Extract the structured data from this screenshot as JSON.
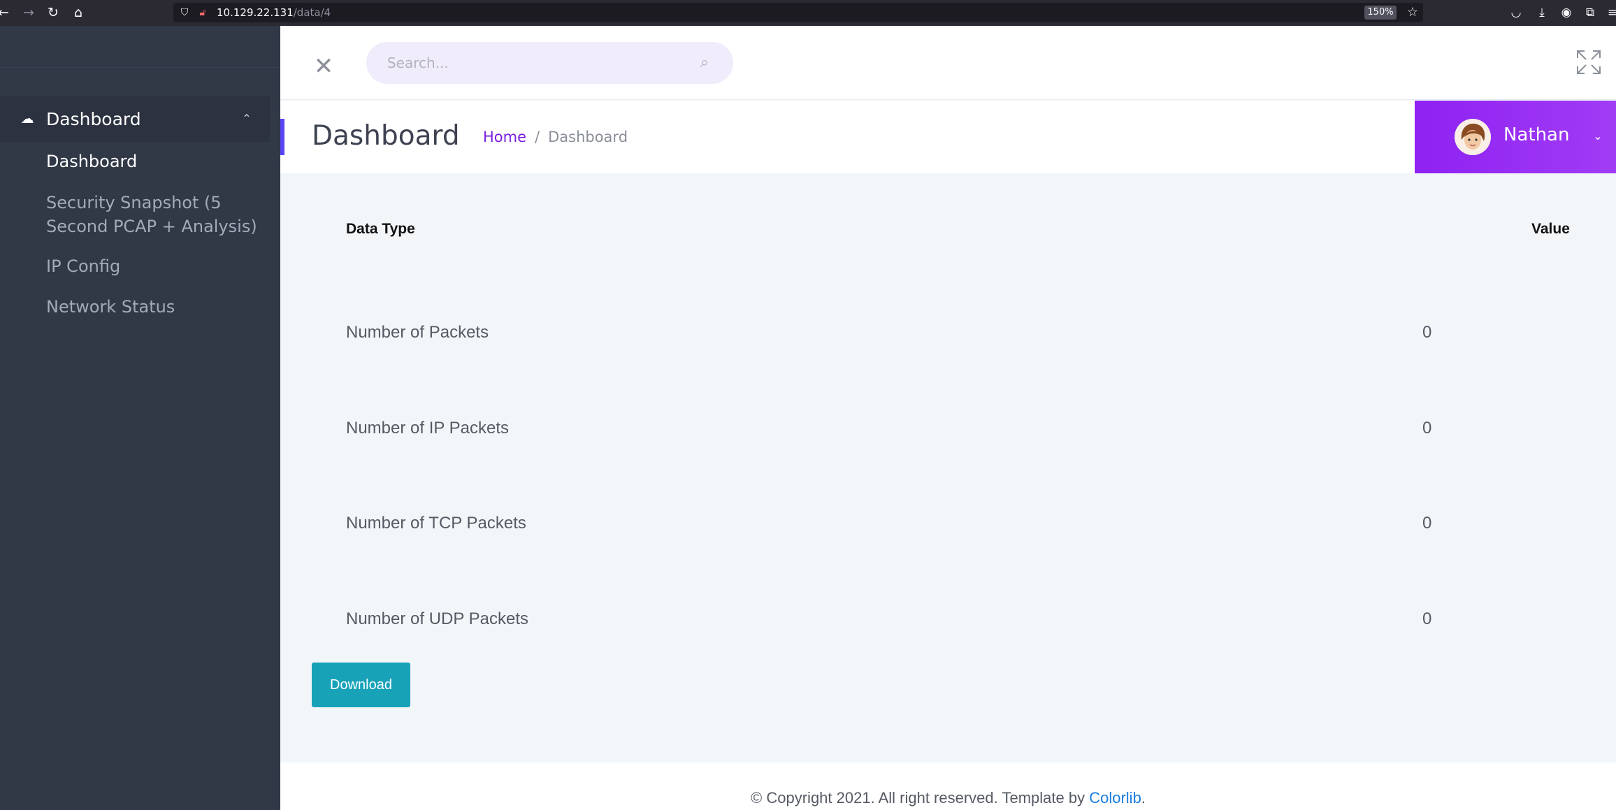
{
  "browser": {
    "url_host": "10.129.22.131",
    "url_path": "/data/4",
    "zoom": "150%"
  },
  "sidebar": {
    "group_label": "Dashboard",
    "group_icon": "cloud-upload-icon",
    "items": [
      {
        "label": "Dashboard",
        "active": true
      },
      {
        "label": "Security Snapshot (5 Second PCAP + Analysis)",
        "active": false
      },
      {
        "label": "IP Config",
        "active": false
      },
      {
        "label": "Network Status",
        "active": false
      }
    ]
  },
  "header": {
    "search_placeholder": "Search..."
  },
  "titlebar": {
    "title": "Dashboard",
    "breadcrumb": {
      "home": "Home",
      "separator": "/",
      "current": "Dashboard"
    },
    "user_name": "Nathan",
    "accent_color": "#5a46f5",
    "user_gradient": [
      "#8f21f2",
      "#a13cf5"
    ]
  },
  "table": {
    "headers": {
      "type": "Data Type",
      "value": "Value"
    },
    "rows": [
      {
        "label": "Number of Packets",
        "value": "0"
      },
      {
        "label": "Number of IP Packets",
        "value": "0"
      },
      {
        "label": "Number of TCP Packets",
        "value": "0"
      },
      {
        "label": "Number of UDP Packets",
        "value": "0"
      }
    ]
  },
  "actions": {
    "download_label": "Download",
    "download_color": "#17a2b8"
  },
  "footer": {
    "text": "© Copyright 2021. All right reserved. Template by ",
    "link": "Colorlib",
    "suffix": "."
  }
}
